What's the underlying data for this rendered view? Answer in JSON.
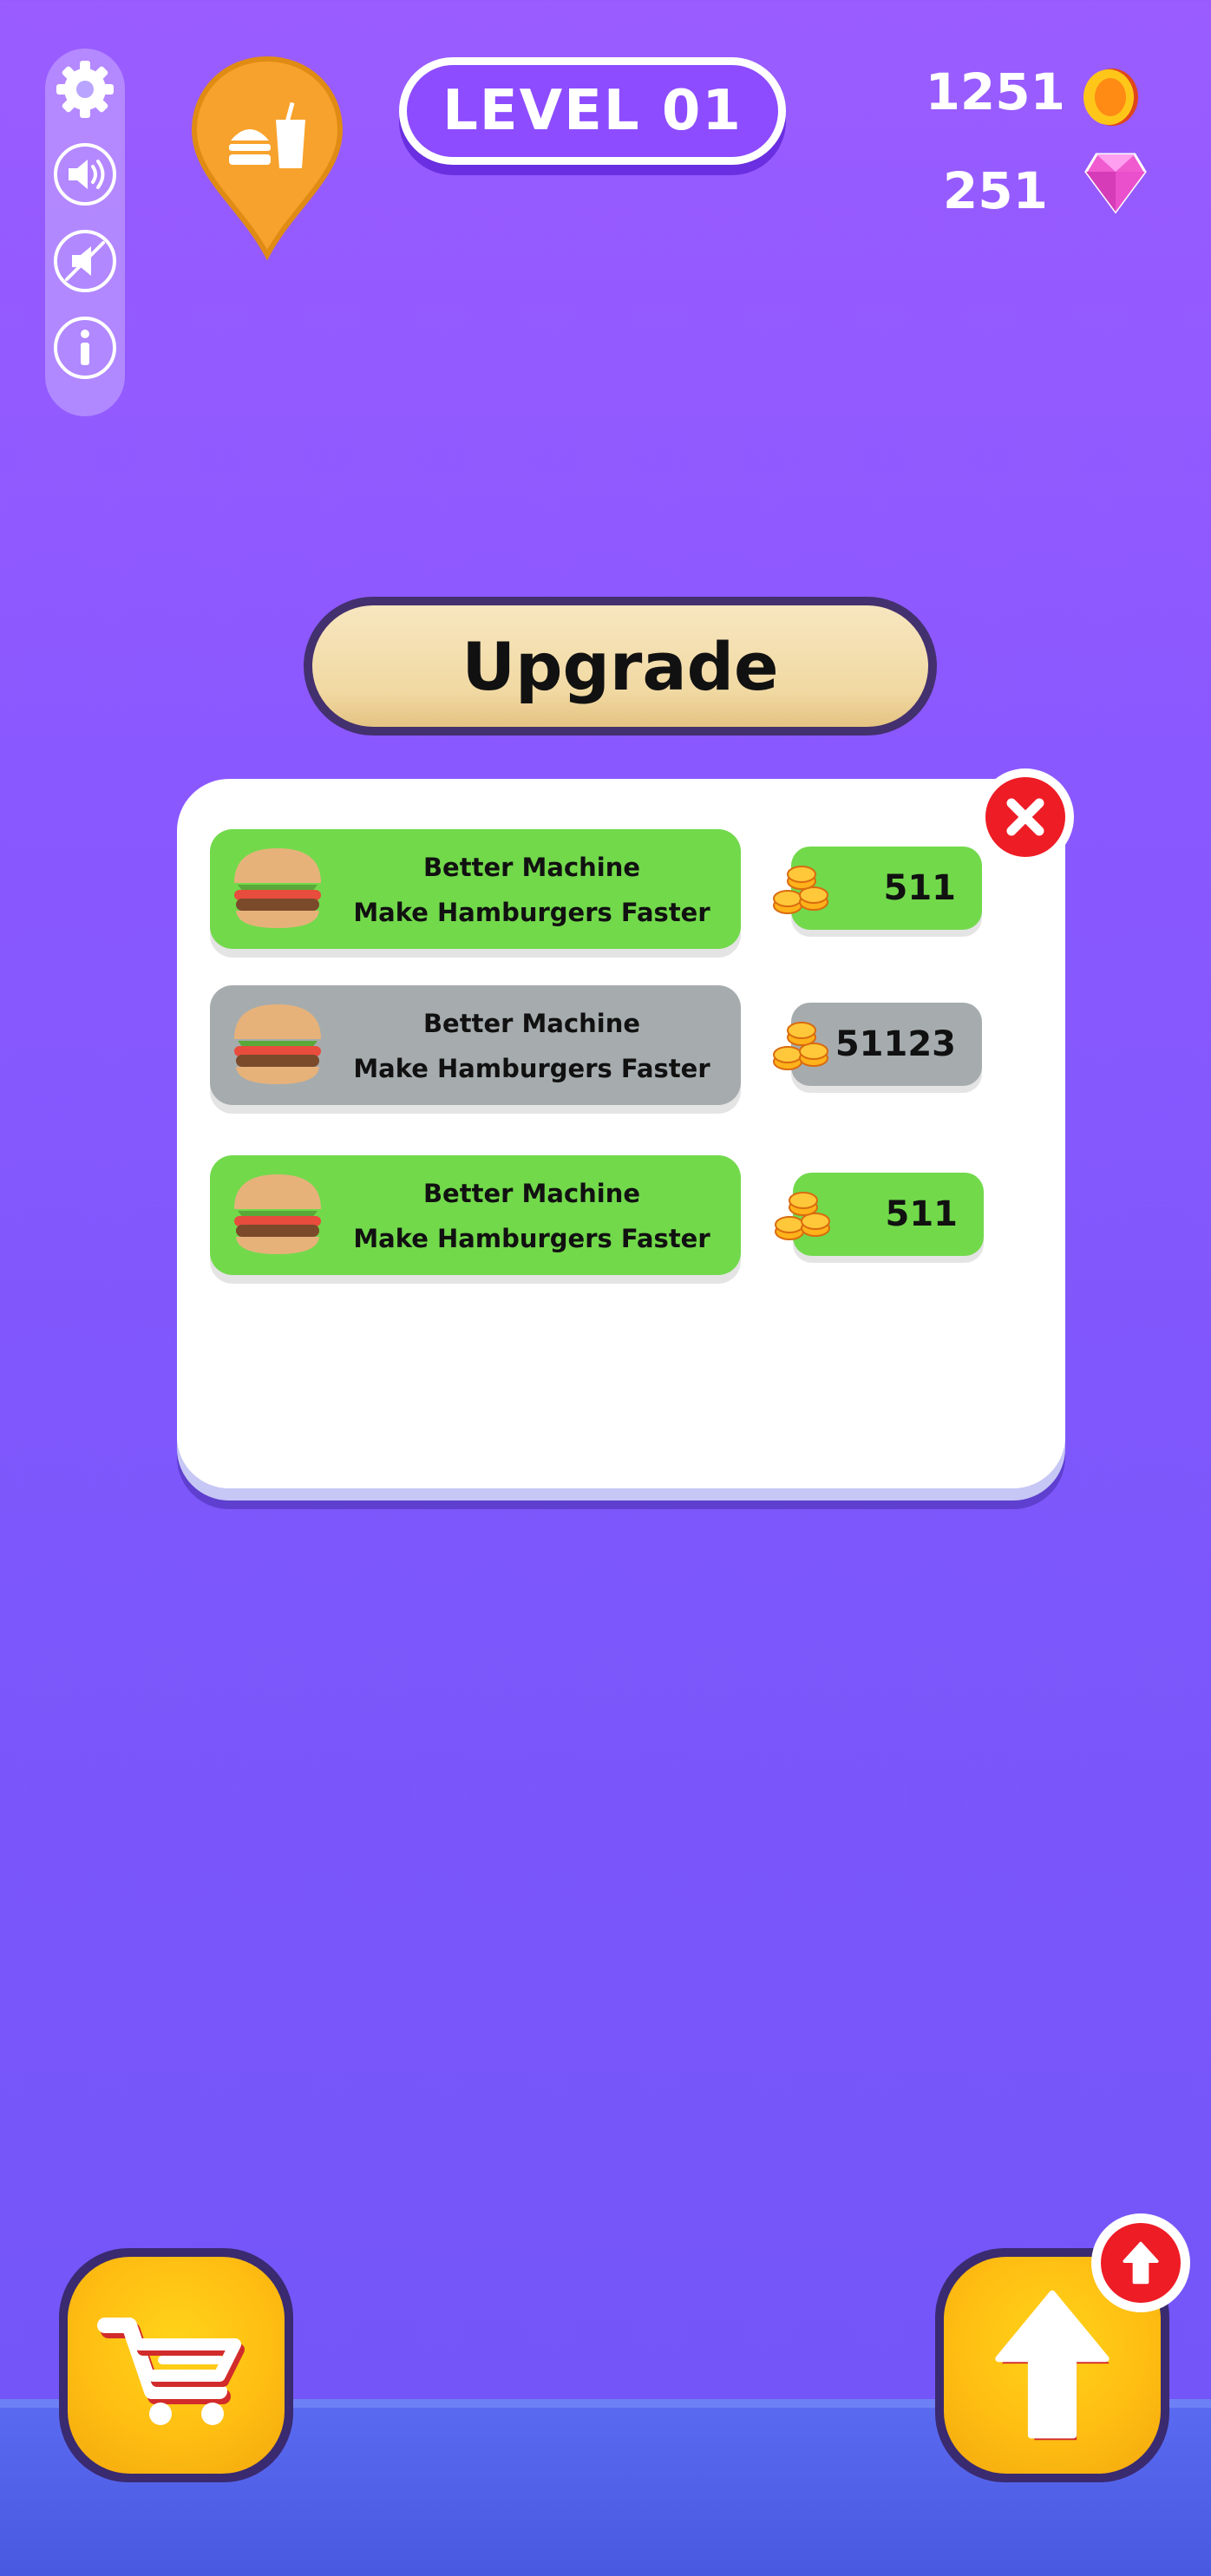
{
  "hud": {
    "level_label": "LEVEL 01",
    "coins": "1251",
    "gems": "251",
    "side_buttons": [
      "gear-icon",
      "speaker-icon",
      "mute-icon",
      "info-icon"
    ],
    "pin_icon": "burger-drink-icon"
  },
  "upgrade": {
    "title": "Upgrade",
    "items": [
      {
        "title": "Better Machine",
        "subtitle": "Make Hamburgers Faster",
        "price": "511",
        "state": "available",
        "color": "#72d94b"
      },
      {
        "title": "Better Machine",
        "subtitle": "Make Hamburgers Faster",
        "price": "51123",
        "state": "locked",
        "color": "#a6acae"
      },
      {
        "title": "Better Machine",
        "subtitle": "Make Hamburgers Faster",
        "price": "511",
        "state": "available",
        "color": "#72d94b"
      }
    ]
  },
  "bottom": {
    "left_button_icon": "shopping-cart-icon",
    "right_button_icon": "up-arrow-icon",
    "notification_icon": "up-arrow-icon"
  },
  "colors": {
    "background": "#8a58ff",
    "accent_yellow": "#ffbe12",
    "close_red": "#ee1c25",
    "available_green": "#72d94b",
    "locked_gray": "#a6acae"
  }
}
